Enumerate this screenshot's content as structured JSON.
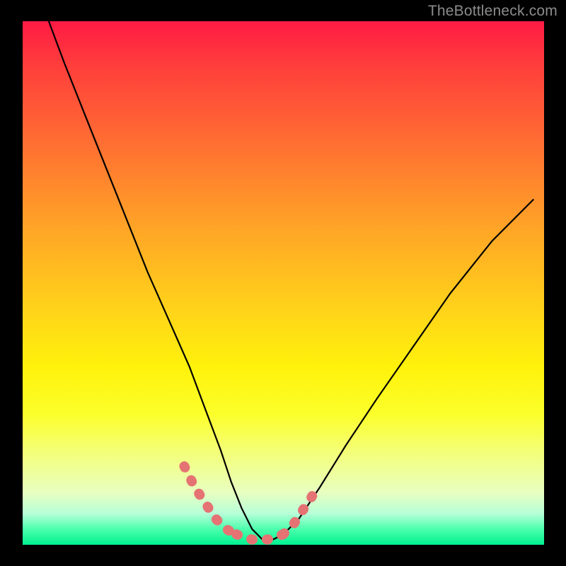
{
  "watermark": "TheBottleneck.com",
  "colors": {
    "background": "#000000",
    "curve": "#000000",
    "marker": "#e57373",
    "gradient_top": "#ff1a44",
    "gradient_bottom": "#00f090"
  },
  "chart_data": {
    "type": "line",
    "title": "",
    "xlabel": "",
    "ylabel": "",
    "xlim": [
      0,
      100
    ],
    "ylim": [
      0,
      100
    ],
    "curve": {
      "x": [
        5,
        8,
        12,
        16,
        20,
        24,
        28,
        32,
        35,
        38,
        40,
        42,
        44,
        46,
        48,
        50,
        53,
        57,
        62,
        68,
        75,
        82,
        90,
        98
      ],
      "y": [
        100,
        92,
        82,
        72,
        62,
        52,
        43,
        34,
        26,
        18,
        12,
        7,
        3,
        1,
        1,
        2,
        5,
        11,
        19,
        28,
        38,
        48,
        58,
        66
      ]
    },
    "highlight_segments": [
      {
        "x": [
          31,
          33,
          35,
          37,
          39,
          41
        ],
        "y": [
          15,
          11,
          8,
          5,
          3,
          2
        ]
      },
      {
        "x": [
          41,
          44,
          47,
          50
        ],
        "y": [
          2,
          1,
          1,
          2
        ]
      },
      {
        "x": [
          50,
          52,
          54,
          56
        ],
        "y": [
          2,
          4,
          7,
          10
        ]
      }
    ],
    "annotations": []
  }
}
